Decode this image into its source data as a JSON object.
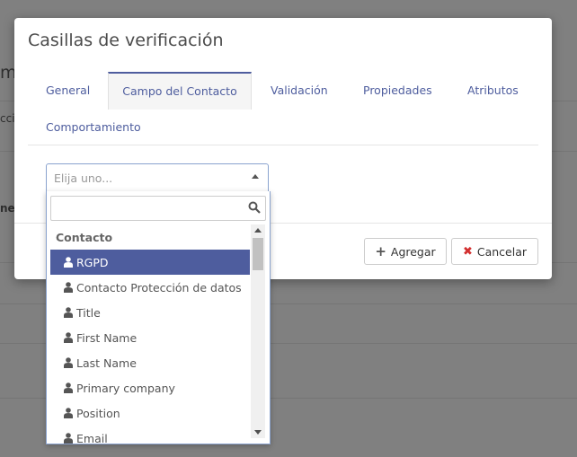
{
  "background": {
    "fragments": [
      "m",
      "cci",
      "ne"
    ]
  },
  "modal": {
    "title": "Casillas de verificación",
    "tabs": [
      {
        "label": "General"
      },
      {
        "label": "Campo del Contacto",
        "active": true
      },
      {
        "label": "Validación"
      },
      {
        "label": "Propiedades"
      },
      {
        "label": "Atributos"
      },
      {
        "label": "Comportamiento"
      }
    ],
    "select": {
      "placeholder": "Elija uno..."
    },
    "footer": {
      "add_label": "Agregar",
      "cancel_label": "Cancelar"
    }
  },
  "dropdown": {
    "search_value": "",
    "group_label": "Contacto",
    "items": [
      {
        "label": "RGPD",
        "selected": true
      },
      {
        "label": "Contacto Protección de datos"
      },
      {
        "label": "Title"
      },
      {
        "label": "First Name"
      },
      {
        "label": "Last Name"
      },
      {
        "label": "Primary company"
      },
      {
        "label": "Position"
      },
      {
        "label": "Email"
      }
    ]
  },
  "colors": {
    "accent": "#4e5d9e",
    "cancel_icon": "#d32f2f"
  },
  "icons": {
    "search": "search-icon",
    "user": "user-icon",
    "plus": "plus-icon",
    "cancel": "close-icon"
  }
}
